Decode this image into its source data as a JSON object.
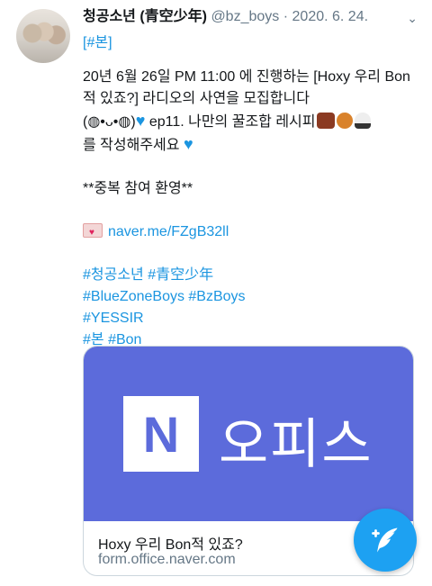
{
  "author": {
    "name": "청공소년 (青空少年)",
    "handle": "@bz_boys",
    "separator": "·",
    "date": "2020. 6. 24."
  },
  "chevron_icon": "chevron-down-icon",
  "tweet": {
    "tag_line": "[#본]",
    "line1": "20년 6월 26일 PM 11:00 에 진행하는 [Hoxy 우리 Bon적 있죠?] 라디오의 사연을 모집합니다",
    "line2_prefix": "(◍•ᴗ•◍)",
    "line2_text": " ep11. 나만의 꿀조합 레시피",
    "line3": "를 작성해주세요",
    "welcome": "**중복 참여 환영**",
    "link": "naver.me/FZgB32ll",
    "hashtags_line1": "#청공소년 #青空少年",
    "hashtags_line2": "#BlueZoneBoys #BzBoys",
    "hashtags_line3": "#YESSIR",
    "hashtags_line4": "#본 #Bon"
  },
  "card": {
    "image_letter": "N",
    "image_text": "오피스",
    "title": "Hoxy 우리 Bon적 있죠?",
    "url": "form.office.naver.com"
  },
  "fab": {
    "label": "+",
    "icon": "compose-feather-icon"
  },
  "colors": {
    "link": "#1b95e0",
    "card_bg": "#5c6bdb",
    "fab": "#1da1f2"
  }
}
